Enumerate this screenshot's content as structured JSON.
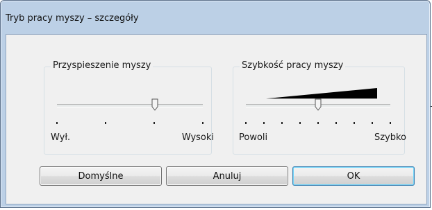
{
  "window": {
    "title": "Tryb pracy myszy – szczegóły"
  },
  "acceleration": {
    "legend": "Przyspieszenie myszy",
    "min_label": "Wył.",
    "max_label": "Wysoki",
    "level_fraction": 0.67,
    "tick_count": 4
  },
  "speed": {
    "legend": "Szybkość pracy myszy",
    "min_label": "Powoli",
    "max_label": "Szybko",
    "level_fraction": 0.5,
    "tick_count": 9
  },
  "buttons": {
    "defaults": "Domyślne",
    "cancel": "Anuluj",
    "ok": "OK"
  }
}
